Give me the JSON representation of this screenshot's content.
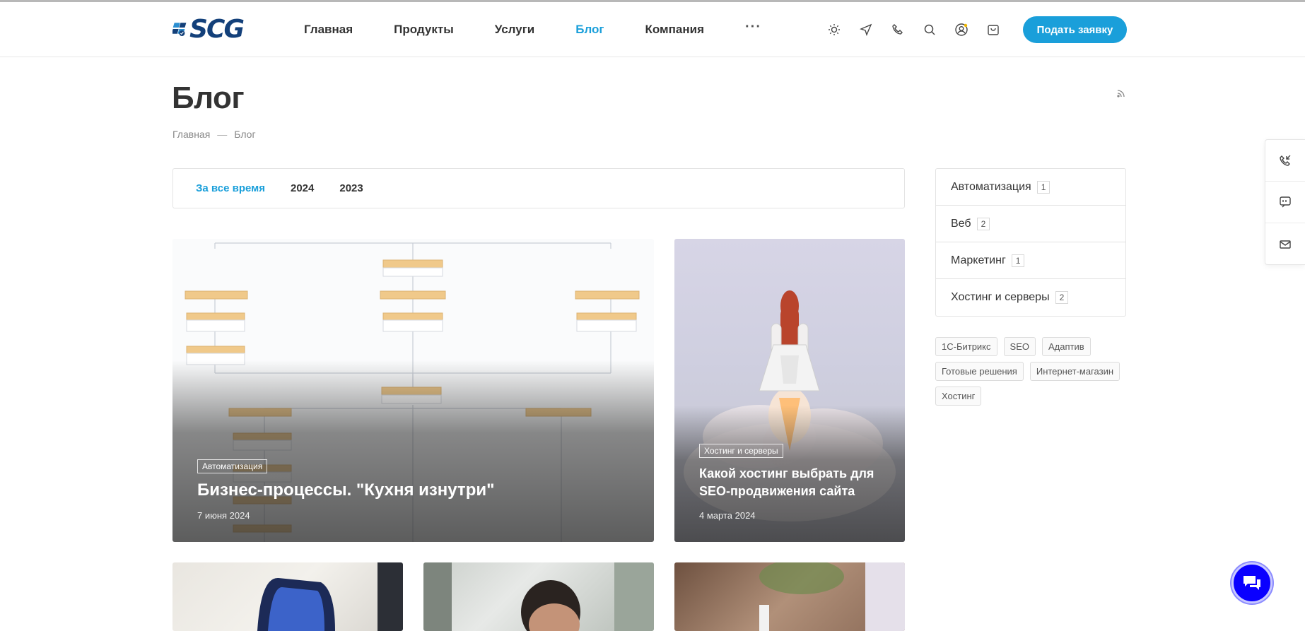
{
  "header": {
    "logo_text": "SCG",
    "nav": [
      "Главная",
      "Продукты",
      "Услуги",
      "Блог",
      "Компания"
    ],
    "nav_active": "Блог",
    "more_label": "···",
    "icons": [
      "sun-icon",
      "send-icon",
      "phone-icon",
      "search-icon",
      "user-icon",
      "cart-icon"
    ],
    "cta_label": "Подать заявку"
  },
  "page": {
    "title": "Блог",
    "breadcrumb": [
      "Главная",
      "—",
      "Блог"
    ]
  },
  "filter": {
    "items": [
      "За все время",
      "2024",
      "2023"
    ],
    "active": "За все время"
  },
  "posts": [
    {
      "category": "Автоматизация",
      "title": "Бизнес-процессы. \"Кухня изнутри\"",
      "date": "7 июня 2024"
    },
    {
      "category": "Хостинг и серверы",
      "title": "Какой хостинг выбрать для SEO-продвижения сайта",
      "date": "4 марта 2024"
    }
  ],
  "sidebar": {
    "categories": [
      {
        "name": "Автоматизация",
        "count": "1"
      },
      {
        "name": "Веб",
        "count": "2"
      },
      {
        "name": "Маркетинг",
        "count": "1"
      },
      {
        "name": "Хостинг и серверы",
        "count": "2"
      }
    ],
    "tags": [
      "1С-Битрикс",
      "SEO",
      "Адаптив",
      "Готовые решения",
      "Интернет-магазин",
      "Хостинг"
    ]
  },
  "colors": {
    "accent": "#1a9fda",
    "chat": "#0a00ff",
    "logo": "#13407a"
  }
}
